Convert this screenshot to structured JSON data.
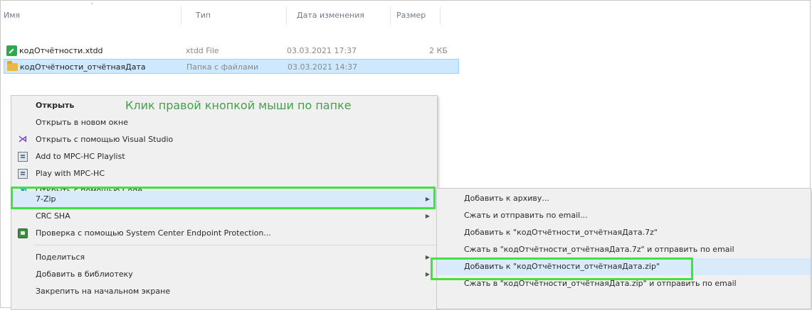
{
  "header": {
    "col_name": "Имя",
    "col_type": "Тип",
    "col_date": "Дата изменения",
    "col_size": "Размер",
    "sort_caret": "˄"
  },
  "files": [
    {
      "name": "кодОтчётности.xtdd",
      "type": "xtdd File",
      "date": "03.03.2021 17:37",
      "size": "2 КБ",
      "icon": "xtdd-file-icon"
    },
    {
      "name": "кодОтчётности_отчётнаяДата",
      "type": "Папка с файлами",
      "date": "03.03.2021 14:37",
      "size": "",
      "icon": "folder-icon"
    }
  ],
  "annotation": "Клик правой кнопкой мыши по папке",
  "context_menu": {
    "items": [
      {
        "label": "Открыть",
        "bold": true
      },
      {
        "label": "Открыть в новом окне"
      },
      {
        "label": "Открыть с помощью Visual Studio",
        "icon": "visual-studio-icon"
      },
      {
        "label": "Add to MPC-HC Playlist",
        "icon": "mpc-hc-icon"
      },
      {
        "label": "Play with MPC-HC",
        "icon": "mpc-hc-icon"
      },
      {
        "label": "Открыть с помощью Code",
        "icon": "vscode-icon"
      },
      {
        "label": "7-Zip",
        "submenu": true
      },
      {
        "label": "CRC SHA",
        "submenu": true
      },
      {
        "label": "Проверка с помощью System Center Endpoint Protection...",
        "icon": "endpoint-protection-icon"
      },
      {
        "label": "Поделиться",
        "submenu": true
      },
      {
        "label": "Добавить в библиотеку",
        "submenu": true
      },
      {
        "label": "Закрепить на начальном экране"
      }
    ]
  },
  "submenu_7zip": {
    "items": [
      {
        "label": "Добавить к архиву..."
      },
      {
        "label": "Сжать и отправить по email..."
      },
      {
        "label": "Добавить к \"кодОтчётности_отчётнаяДата.7z\""
      },
      {
        "label": "Сжать в \"кодОтчётности_отчётнаяДата.7z\" и отправить по email"
      },
      {
        "label": "Добавить к \"кодОтчётности_отчётнаяДата.zip\""
      },
      {
        "label": "Сжать в \"кодОтчётности_отчётнаяДата.zip\" и отправить по email"
      }
    ]
  },
  "colors": {
    "annotation": "#43a04a",
    "highlight_box": "#3fe23f",
    "selection": "#cde8ff"
  }
}
